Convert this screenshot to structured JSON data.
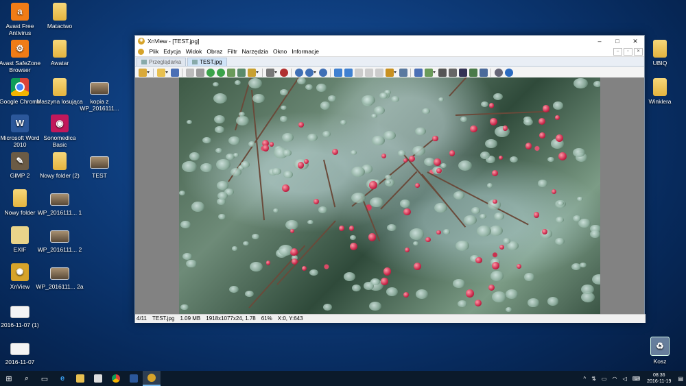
{
  "desktop": {
    "icons": [
      {
        "label": "Avast Free Antivirus",
        "icon": "avast-icon"
      },
      {
        "label": "Avast SafeZone Browser",
        "icon": "avast-safezone-icon"
      },
      {
        "label": "Google Chrome",
        "icon": "chrome-icon"
      },
      {
        "label": "Microsoft Word 2010",
        "icon": "word-icon"
      },
      {
        "label": "GIMP 2",
        "icon": "gimp-icon"
      },
      {
        "label": "Nowy folder",
        "icon": "folder-icon"
      },
      {
        "label": "EXIF",
        "icon": "file-icon"
      },
      {
        "label": "XnView",
        "icon": "xnview-icon"
      },
      {
        "label": "2016-11-07 (1)",
        "icon": "image-file-icon"
      },
      {
        "label": "2016-11-07",
        "icon": "image-file-icon"
      },
      {
        "label": "Matactwo",
        "icon": "folder-icon"
      },
      {
        "label": "Awatar",
        "icon": "folder-icon"
      },
      {
        "label": "Maszyna losująca",
        "icon": "folder-icon"
      },
      {
        "label": "Sonomedica Basic",
        "icon": "sonomedica-icon"
      },
      {
        "label": "Nowy folder (2)",
        "icon": "folder-icon"
      },
      {
        "label": "WP_2016111... 1",
        "icon": "image-file-icon"
      },
      {
        "label": "WP_2016111... 2",
        "icon": "image-file-icon"
      },
      {
        "label": "WP_2016111... 2a",
        "icon": "image-file-icon"
      },
      {
        "label": "kopia z WP_2016111...",
        "icon": "image-file-icon"
      },
      {
        "label": "TEST",
        "icon": "image-file-icon"
      },
      {
        "label": "UBIQ",
        "icon": "folder-icon"
      },
      {
        "label": "Winklera",
        "icon": "folder-icon"
      },
      {
        "label": "Kosz",
        "icon": "recycle-bin-icon"
      }
    ]
  },
  "window": {
    "title": "XnView - [TEST.jpg]",
    "controls": {
      "minimize": "–",
      "maximize": "□",
      "close": "✕"
    },
    "menu": [
      "Plik",
      "Edycja",
      "Widok",
      "Obraz",
      "Filtr",
      "Narzędzia",
      "Okno",
      "Informacje"
    ],
    "tabs": [
      {
        "label": "Przeglądarka",
        "active": false
      },
      {
        "label": "TEST.jpg",
        "active": true
      }
    ],
    "status": {
      "index": "4/11",
      "filename": "TEST.jpg",
      "size": "1.09 MB",
      "dims": "1918x1077x24, 1.78",
      "zoom": "61%",
      "coords": "X:0, Y:643"
    }
  },
  "taskbar": {
    "clock_time": "08:36",
    "clock_date": "2016-11-19",
    "tray_chevron": "^"
  }
}
